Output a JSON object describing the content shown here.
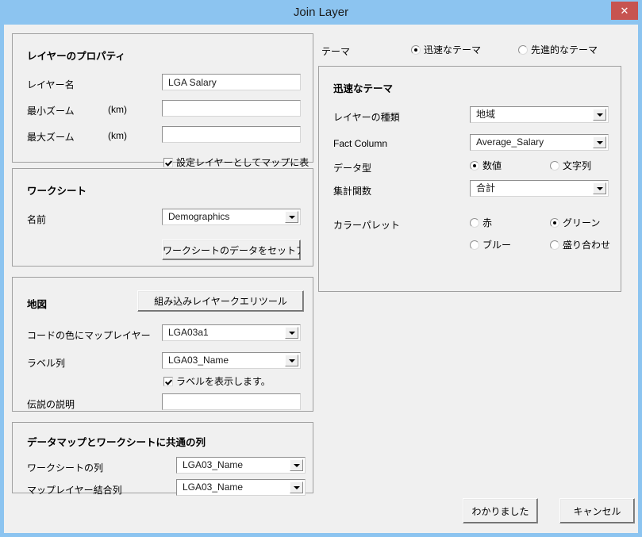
{
  "window": {
    "title": "Join Layer",
    "close_label": "✕"
  },
  "layer_properties": {
    "title": "レイヤーのプロパティ",
    "layer_name_label": "レイヤー名",
    "layer_name_value": "LGA Salary",
    "min_zoom_label": "最小ズーム",
    "min_zoom_unit": "(km)",
    "min_zoom_value": "",
    "max_zoom_label": "最大ズーム",
    "max_zoom_unit": "(km)",
    "max_zoom_value": "",
    "show_as_config_layer_label": "設定レイヤーとしてマップに表",
    "show_as_config_layer_checked": true
  },
  "worksheet": {
    "title": "ワークシート",
    "name_label": "名前",
    "name_value": "Demographics",
    "setup_button": "ワークシートのデータをセットアップしま"
  },
  "map": {
    "title": "地図",
    "query_tool_button": "組み込みレイヤークエリツール",
    "color_code_layer_label": "コードの色にマップレイヤー",
    "color_code_layer_value": "LGA03a1",
    "label_column_label": "ラベル列",
    "label_column_value": "LGA03_Name",
    "show_labels_label": "ラベルを表示します。",
    "show_labels_checked": true,
    "legend_description_label": "伝説の説明",
    "legend_description_value": ""
  },
  "common_columns": {
    "title": "データマップとワークシートに共通の列",
    "worksheet_column_label": "ワークシートの列",
    "worksheet_column_value": "LGA03_Name",
    "map_layer_join_column_label": "マップレイヤー結合列",
    "map_layer_join_column_value": "LGA03_Name"
  },
  "theme": {
    "label": "テーマ",
    "quick_option": "迅速なテーマ",
    "advanced_option": "先進的なテーマ",
    "selected": "quick"
  },
  "quick_theme": {
    "title": "迅速なテーマ",
    "layer_type_label": "レイヤーの種類",
    "layer_type_value": "地域",
    "fact_column_label": "Fact Column",
    "fact_column_value": "Average_Salary",
    "data_type_label": "データ型",
    "data_type_numeric": "数値",
    "data_type_string": "文字列",
    "data_type_selected": "numeric",
    "aggregate_label": "集計関数",
    "aggregate_value": "合計",
    "palette_label": "カラーパレット",
    "palette_red": "赤",
    "palette_green": "グリーン",
    "palette_blue": "ブルー",
    "palette_mixed": "盛り合わせ",
    "palette_selected": "green"
  },
  "footer": {
    "ok_button": "わかりました",
    "cancel_button": "キャンセル"
  },
  "colors": {
    "titlebar": "#8cc4f0",
    "close": "#c75450",
    "dialog_bg": "#f0f0f0"
  }
}
